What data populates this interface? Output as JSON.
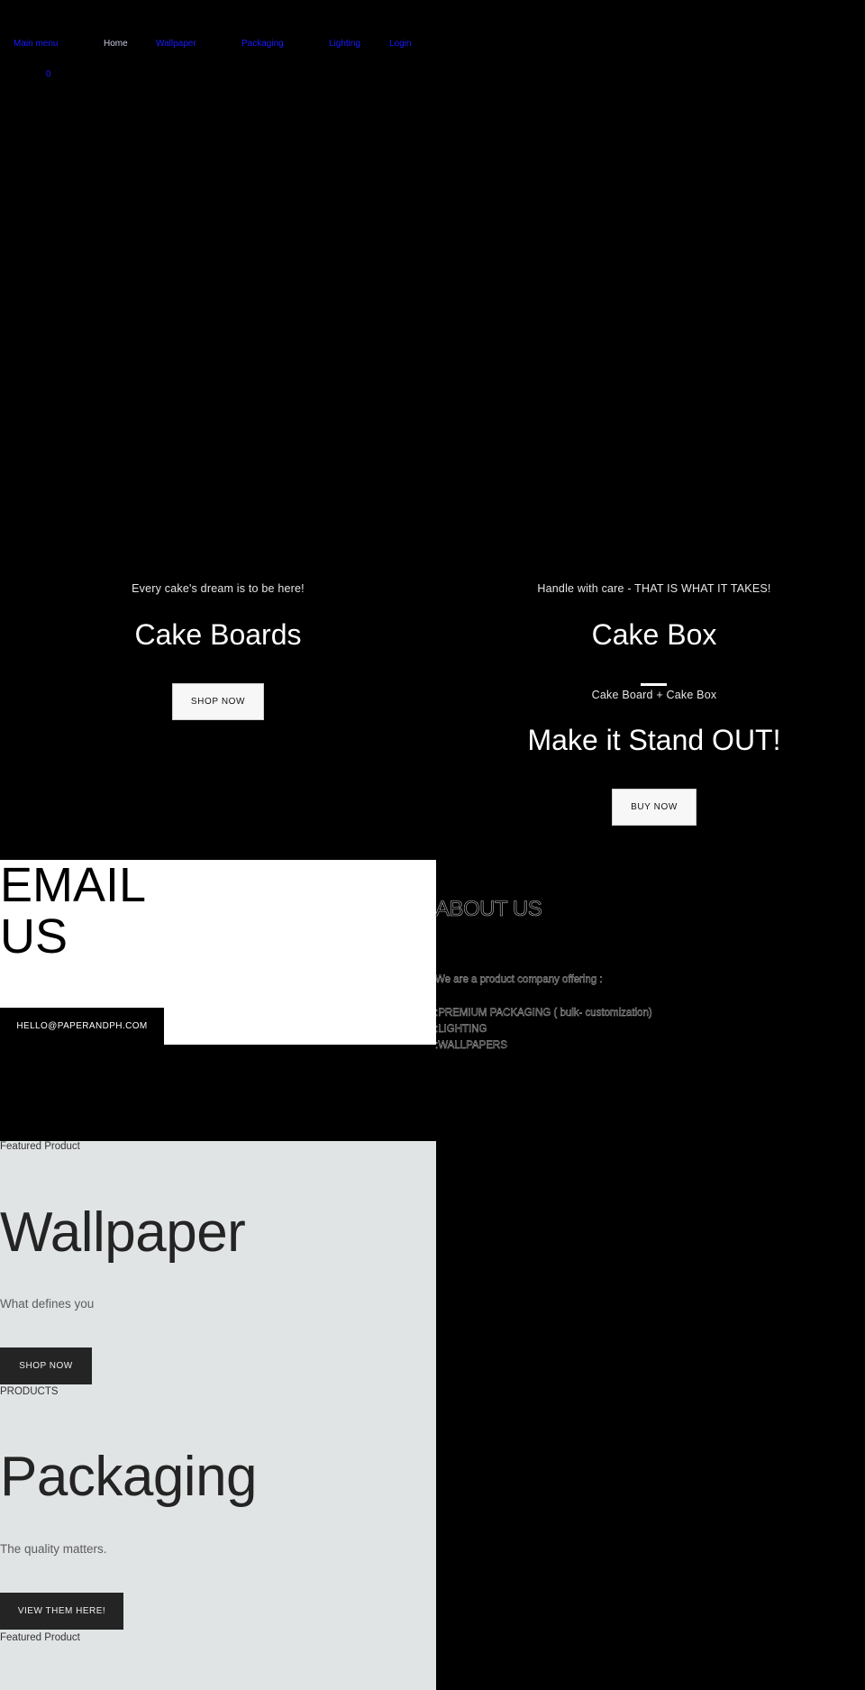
{
  "header": {
    "nav": [
      {
        "label": "Main menu"
      },
      {
        "label": "Home",
        "active": true
      },
      {
        "label": "Wallpaper"
      },
      {
        "label": "Packaging"
      },
      {
        "label": "Lighting"
      },
      {
        "label": "Login"
      }
    ],
    "cart_count": "0",
    "link_color": "#1a1aff"
  },
  "hero": {
    "left": {
      "eyebrow": "Every cake's dream is to be here!",
      "title": "Cake Boards",
      "button": "SHOP NOW"
    },
    "right": {
      "eyebrow": "Handle with care - THAT IS WHAT IT TAKES!",
      "title": "Cake Box",
      "subtitle": "Cake Board + Cake Box",
      "title2": "Make it Stand OUT!",
      "button": "BUY NOW"
    }
  },
  "email": {
    "title_line1": "EMAIL",
    "title_line2": "US",
    "button": "HELLO@PAPERANDPH.COM"
  },
  "about": {
    "title": "ABOUT US",
    "intro": "We are a product company offering :",
    "items": [
      ":PREMIUM PACKAGING ( bulk- customization)",
      ":LIGHTING",
      ":WALLPAPERS"
    ]
  },
  "featured": [
    {
      "label": "Featured Product",
      "title": "Wallpaper",
      "subtitle": "What defines you",
      "button": "SHOP NOW"
    },
    {
      "label": "PRODUCTS",
      "title": "Packaging",
      "subtitle": "The quality matters.",
      "button": "VIEW THEM HERE!"
    },
    {
      "label": "Featured Product"
    }
  ],
  "colors": {
    "page_bg": "#000000",
    "email_bg": "#ffffff",
    "featured_bg": "#e1e4e5",
    "dark_button": "#242424",
    "light_button": "#f7f7f7"
  }
}
